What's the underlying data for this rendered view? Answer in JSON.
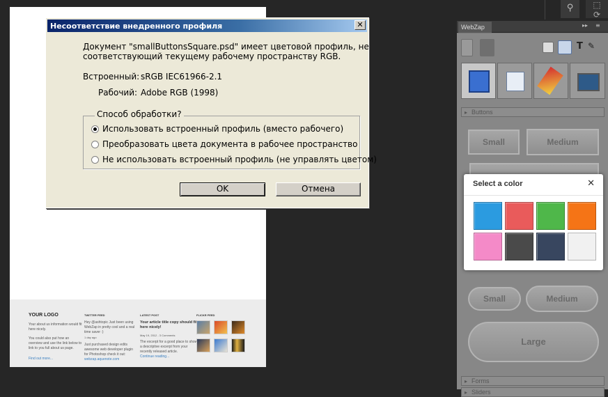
{
  "dialog": {
    "title": "Несоответствие внедренного профиля",
    "close_glyph": "✕",
    "message_line1": "Документ \"smallButtonsSquare.psd\" имеет цветовой профиль, не",
    "message_line2": "соответствующий текущему рабочему пространству RGB.",
    "embedded_label": "Встроенный:",
    "embedded_value": "sRGB IEC61966-2.1",
    "working_label": "Рабочий:",
    "working_value": "Adobe RGB (1998)",
    "group_label": "Способ обработки?",
    "options": [
      {
        "label": "Использовать встроенный профиль (вместо рабочего)",
        "selected": true
      },
      {
        "label": "Преобразовать цвета документа в рабочее пространство",
        "selected": false
      },
      {
        "label": "Не использовать встроенный профиль (не управлять цветом)",
        "selected": false
      }
    ],
    "ok_label": "OK",
    "cancel_label": "Отмена"
  },
  "document_footer": {
    "logo": "YOUR LOGO",
    "about": [
      "Your about us information would fit",
      "here nicely.",
      "",
      "You could also put how an",
      "overview and use the link below to",
      "link to you full about us page."
    ],
    "find_out": "Find out more...",
    "col2_title": "TWITTER FEED",
    "col2_text": [
      "Hey @ashtopic Just been using",
      "WebZap in pretty cool and a real",
      "time saver :)",
      "1 day ago",
      "",
      "Just purchased design edits",
      "awesome web developer plugin",
      "for Photoshop check it out:",
      "webzap.aquenote.com"
    ],
    "col3_title": "LATEST POST",
    "col3_heading": [
      "Your article title copy should fit",
      "here nicely!"
    ],
    "col3_date": "May 19, 2012 - 3 Comments",
    "col3_text": [
      "The excerpt for a good place to show",
      "a descriptive excerpt from your",
      "recently released article."
    ],
    "col3_link": "Continue reading...",
    "col4_title": "FLICKR FEED"
  },
  "panel": {
    "tab_label": "WebZap",
    "collapse_glyph": "▸▸",
    "menu_glyph": "≡",
    "sections": [
      "Buttons",
      "Forms",
      "Sliders"
    ],
    "button_labels": [
      "Small",
      "Medium",
      "Small",
      "Medium",
      "Large"
    ]
  },
  "color_popup": {
    "title": "Select a color",
    "close_glyph": "✕",
    "swatches": [
      "#2b9be0",
      "#e95b5b",
      "#4fb74a",
      "#f57416",
      "#f48ac8",
      "#4a4a4a",
      "#38465f",
      "#f1f1f1"
    ]
  },
  "icons": {
    "toolbar_tool": "hand-tool-icon",
    "toolbar_marquee": "marquee-icon"
  }
}
